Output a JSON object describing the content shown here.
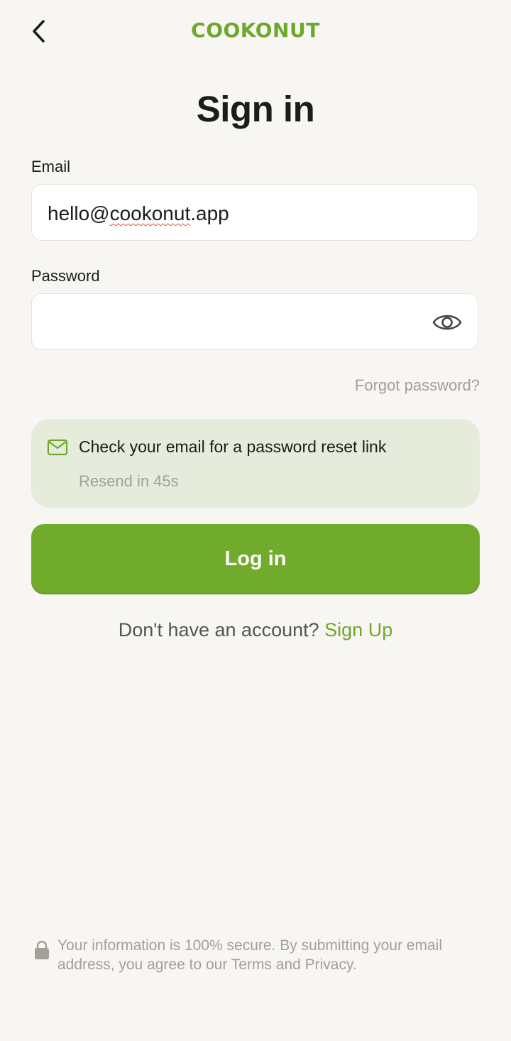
{
  "header": {
    "logo_text": "COOKONUT",
    "logo_color": "#6ea82b",
    "back_icon": "chevron-left-icon"
  },
  "title": "Sign in",
  "email": {
    "label": "Email",
    "value_start": "hello@",
    "value_misspelled": "cookonut",
    "value_end": ".app"
  },
  "password": {
    "label": "Password",
    "value": "",
    "toggle_icon": "eye-icon"
  },
  "forgot_password": "Forgot password?",
  "notice": {
    "icon": "mail-icon",
    "message": "Check your email for a password reset link",
    "resend": "Resend in 45s"
  },
  "login_button": "Log in",
  "signup": {
    "prompt": "Don't have an account?",
    "link": "Sign Up"
  },
  "footer": {
    "icon": "lock-icon",
    "text": "Your information is 100% secure. By submitting your email address, you agree to our Terms and Privacy."
  },
  "colors": {
    "accent": "#71ab2b",
    "background": "#f7f6f2",
    "notice_bg": "#e5ecdb",
    "muted_text": "#a3a09a"
  }
}
